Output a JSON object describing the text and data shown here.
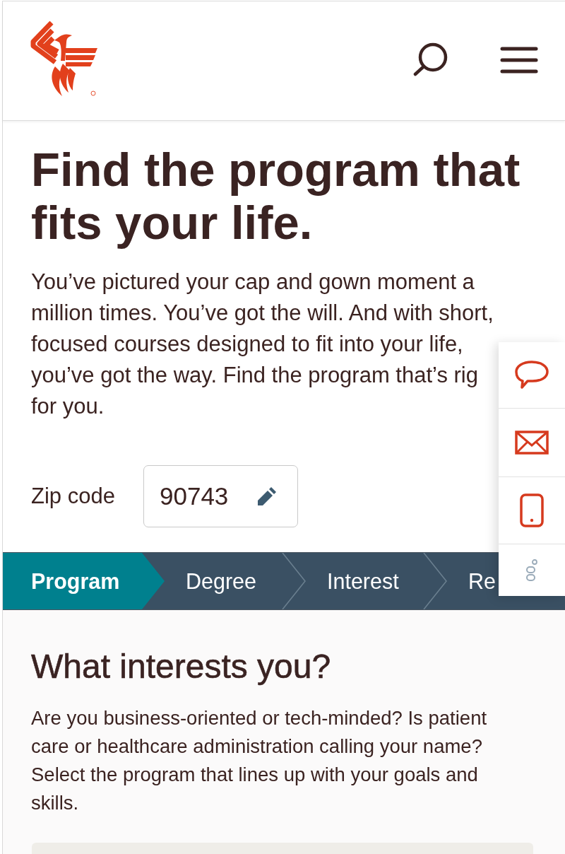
{
  "hero": {
    "title": "Find the program that fits your life.",
    "intro": "You’ve pictured your cap and gown moment a\nmillion times. You’ve got the will. And with short,\nfocused courses designed to fit into your life,\nyou’ve got the way. Find the program that’s rig\nfor you."
  },
  "zip_code": {
    "label": "Zip code",
    "value": "90743"
  },
  "steps": [
    {
      "label": "Program",
      "selected": true
    },
    {
      "label": "Degree",
      "selected": false
    },
    {
      "label": "Interest",
      "selected": false
    },
    {
      "label": "Re",
      "selected": false
    }
  ],
  "interests": {
    "title": "What interests you?",
    "text": "Are you business-oriented or tech-minded? Is patient care or healthcare administration calling your name? Select the program that lines up with your goals and skills."
  }
}
